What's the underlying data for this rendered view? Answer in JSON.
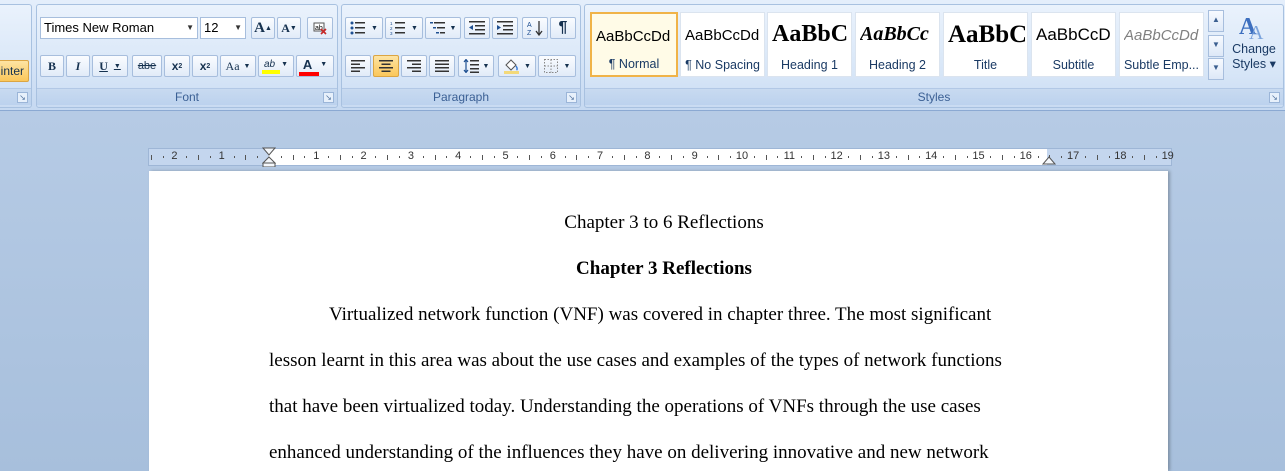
{
  "clipboard": {
    "format_painter_fragment": "inter"
  },
  "font_group": {
    "label": "Font",
    "font_name": "Times New Roman",
    "font_size": "12",
    "grow_label": "A",
    "shrink_label": "A",
    "bold_label": "B",
    "italic_label": "I",
    "underline_label": "U",
    "strike_label": "abe",
    "subscript_label": "x",
    "superscript_label": "x",
    "change_case_label": "Aa",
    "highlight_label": "ab",
    "font_color_label": "A",
    "highlight_color": "#ffff00",
    "font_color": "#ff0000"
  },
  "paragraph_group": {
    "label": "Paragraph",
    "show_marks_label": "¶"
  },
  "styles_group": {
    "label": "Styles",
    "items": [
      {
        "sample": "AaBbCcDd",
        "name": "¶ Normal"
      },
      {
        "sample": "AaBbCcDd",
        "name": "¶ No Spacing"
      },
      {
        "sample": "AaBbC",
        "name": "Heading 1"
      },
      {
        "sample": "AaBbCc",
        "name": "Heading 2"
      },
      {
        "sample": "AaBbC",
        "name": "Title"
      },
      {
        "sample": "AaBbCcD",
        "name": "Subtitle"
      },
      {
        "sample": "AaBbCcDd",
        "name": "Subtle Emp..."
      }
    ],
    "change_styles_line1": "Change",
    "change_styles_line2": "Styles ▾"
  },
  "ruler": {
    "ticks": [
      "2",
      "1",
      "",
      "1",
      "2",
      "3",
      "4",
      "5",
      "6",
      "7",
      "8",
      "9",
      "10",
      "11",
      "12",
      "13",
      "14",
      "15",
      "16",
      "17",
      "18",
      "19"
    ]
  },
  "document": {
    "title": "Chapter 3 to 6 Reflections",
    "heading": "Chapter 3 Reflections",
    "lines": [
      "Virtualized network function (VNF) was covered in chapter three. The most significant",
      "lesson learnt in this area was about the use cases and examples of the types of network functions",
      "that have been virtualized today. Understanding the operations of VNFs through the use cases",
      "enhanced understanding of the influences they have on delivering innovative and new network"
    ]
  }
}
